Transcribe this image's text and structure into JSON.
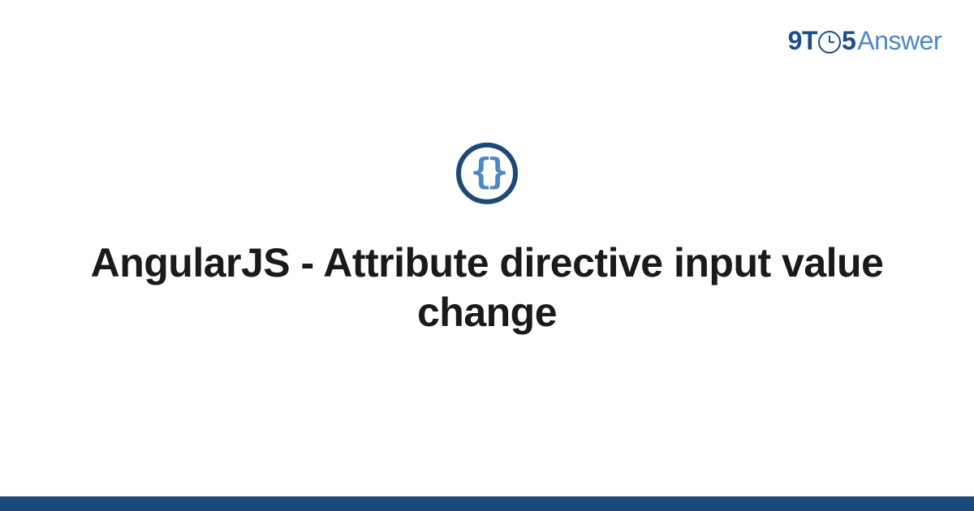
{
  "logo": {
    "part1": "9T",
    "part2": "5",
    "part3": "Answer"
  },
  "icon": {
    "braces": "{}"
  },
  "title": "AngularJS - Attribute directive input value change",
  "colors": {
    "primary": "#1e4976",
    "accent": "#4d88c4",
    "text": "#1a1a1a"
  }
}
